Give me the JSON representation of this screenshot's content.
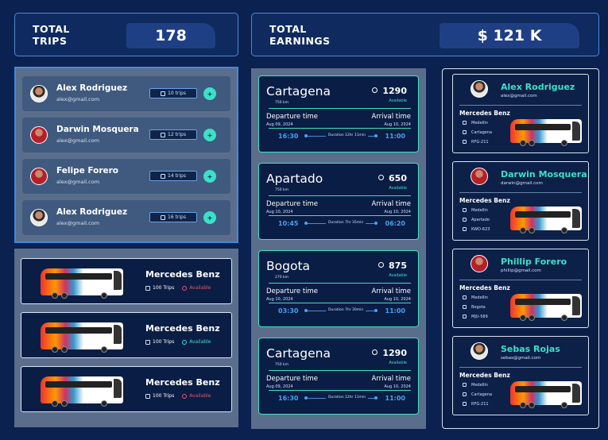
{
  "stats": {
    "trips": {
      "label": "TOTAL TRIPS",
      "value": "178"
    },
    "earnings": {
      "label": "TOTAL EARNINGS",
      "value": "$ 121 K"
    }
  },
  "drivers": [
    {
      "name": "Alex Rodriguez",
      "email": "alex@gmail.com",
      "trips": "10 trips"
    },
    {
      "name": "Darwin Mosquera",
      "email": "alex@gmail.com",
      "trips": "12 trips"
    },
    {
      "name": "Felipe Forero",
      "email": "alex@gmail.com",
      "trips": "14 trips"
    },
    {
      "name": "Alex Rodriguez",
      "email": "alex@gmail.com",
      "trips": "16 trips"
    }
  ],
  "buses": [
    {
      "model": "Mercedes Benz",
      "trips": "100 Trips",
      "status": "Available"
    },
    {
      "model": "Mercedes Benz",
      "trips": "100 Trips",
      "status": "Available"
    },
    {
      "model": "Mercedes Benz",
      "trips": "100 Trips",
      "status": "Available"
    }
  ],
  "trips": [
    {
      "city": "Cartagena",
      "km": "750 km",
      "price": "1290",
      "status": "Available",
      "dep_label": "Departure time",
      "arr_label": "Arrival time",
      "dep_date": "Aug 09, 2024",
      "arr_date": "Aug 10, 2024",
      "dep_time": "16:30",
      "arr_time": "11:00",
      "duration": "Duration 12hr 11min"
    },
    {
      "city": "Apartado",
      "km": "750 km",
      "price": "650",
      "status": "Available",
      "dep_label": "Departure time",
      "arr_label": "Arrival time",
      "dep_date": "Aug 10, 2024",
      "arr_date": "Aug 10, 2024",
      "dep_time": "10:45",
      "arr_time": "06:20",
      "duration": "Duration 7hr 35min"
    },
    {
      "city": "Bogota",
      "km": "270 km",
      "price": "875",
      "status": "Available",
      "dep_label": "Departure time",
      "arr_label": "Arrival time",
      "dep_date": "Aug 10, 2024",
      "arr_date": "Aug 10, 2024",
      "dep_time": "03:30",
      "arr_time": "11:00",
      "duration": "Duration 7hr 30min"
    },
    {
      "city": "Cartagena",
      "km": "750 km",
      "price": "1290",
      "status": "Available",
      "dep_label": "Departure time",
      "arr_label": "Arrival time",
      "dep_date": "Aug 09, 2024",
      "arr_date": "Aug 10, 2024",
      "dep_time": "16:30",
      "arr_time": "11:00",
      "duration": "Duration 12hr 11min"
    }
  ],
  "assignments": [
    {
      "name": "Alex Rodriguez",
      "email": "alex@gmail.com",
      "model": "Mercedes Benz",
      "origin": "Medellin",
      "destination": "Cartagena",
      "plate": "RFG-211"
    },
    {
      "name": "Darwin Mosquera",
      "email": "darwin@gmail.com",
      "model": "Mercedes Benz",
      "origin": "Medellin",
      "destination": "Apartado",
      "plate": "KWO-623"
    },
    {
      "name": "Phillip Forero",
      "email": "phillip@gmail.com",
      "model": "Mercedes Benz",
      "origin": "Medellin",
      "destination": "Bogota",
      "plate": "MJU-589"
    },
    {
      "name": "Sebas Rojas",
      "email": "sebas@gmail.com",
      "model": "Mercedes Benz",
      "origin": "Medellin",
      "destination": "Cartagena",
      "plate": "RFG-211"
    }
  ]
}
